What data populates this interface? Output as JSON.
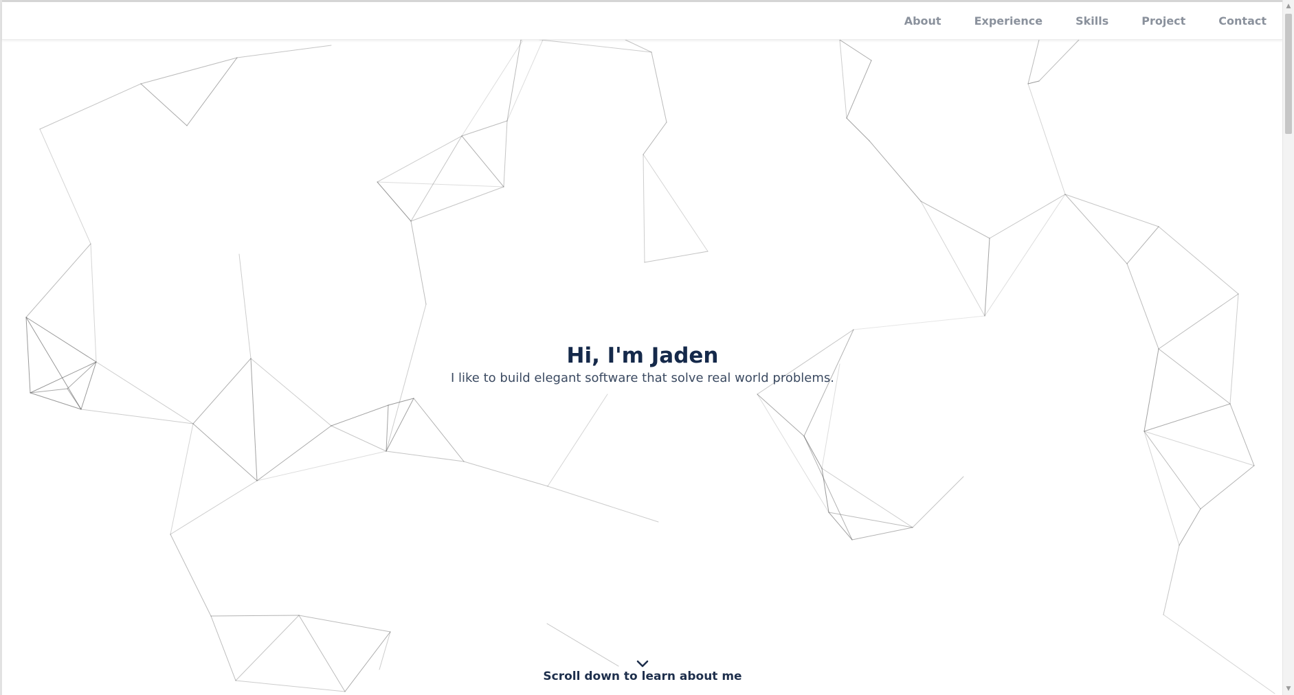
{
  "nav": {
    "items": [
      {
        "label": "About"
      },
      {
        "label": "Experience"
      },
      {
        "label": "Skills"
      },
      {
        "label": "Project"
      },
      {
        "label": "Contact"
      }
    ]
  },
  "hero": {
    "title": "Hi, I'm Jaden",
    "subtitle": "I like to build elegant software that solve real world problems."
  },
  "scroll_cue": {
    "text": "Scroll down to learn about me",
    "icon": "chevron-down-icon"
  },
  "scrollbar": {
    "up_icon": "scroll-up-arrow-icon",
    "down_icon": "scroll-down-arrow-icon"
  },
  "colors": {
    "heading": "#15294a",
    "nav_text": "#8a919c",
    "network_line": "#555555"
  }
}
